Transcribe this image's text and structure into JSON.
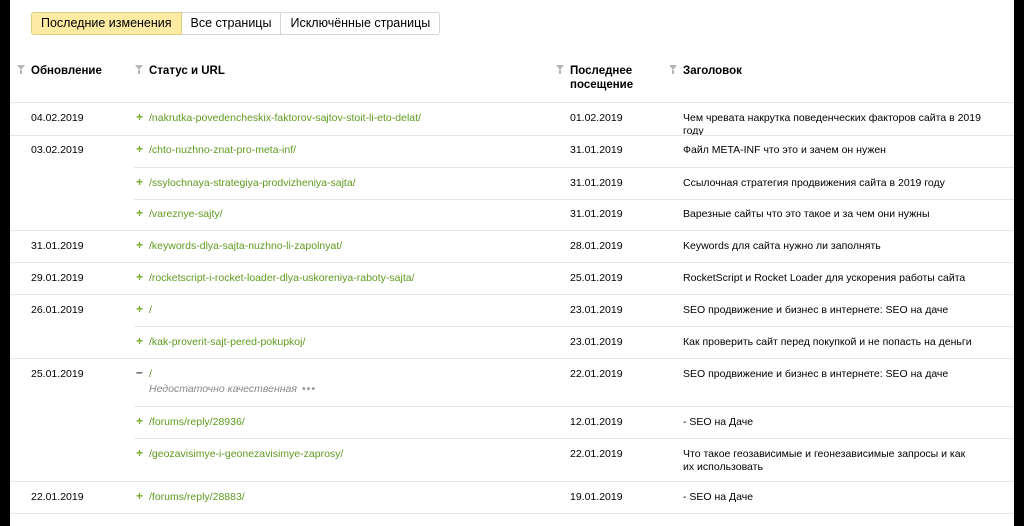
{
  "tabs": [
    {
      "label": "Последние изменения",
      "active": true
    },
    {
      "label": "Все страницы",
      "active": false
    },
    {
      "label": "Исключённые страницы",
      "active": false
    }
  ],
  "columns": {
    "updated": "Обновление",
    "status_url": "Статус и URL",
    "last_visit": "Последнее посещение",
    "title": "Заголовок"
  },
  "rows": [
    {
      "date": "04.02.2019",
      "status": "+",
      "url": "/nakrutka-povedencheskix-faktorov-sajtov-stoit-li-eto-delat/",
      "visit": "01.02.2019",
      "title": "Чем чревата накрутка поведенческих факторов сайта в 2019 году"
    },
    {
      "date": "03.02.2019",
      "status": "+",
      "url": "/chto-nuzhno-znat-pro-meta-inf/",
      "visit": "31.01.2019",
      "title": "Файл META-INF что это и зачем он нужен"
    },
    {
      "date": "",
      "status": "+",
      "url": "/ssylochnaya-strategiya-prodvizheniya-sajta/",
      "visit": "31.01.2019",
      "title": "Ссылочная стратегия продвижения сайта в 2019 году"
    },
    {
      "date": "",
      "status": "+",
      "url": "/vareznye-sajty/",
      "visit": "31.01.2019",
      "title": "Варезные сайты что это такое и за чем они нужны"
    },
    {
      "date": "31.01.2019",
      "status": "+",
      "url": "/keywords-dlya-sajta-nuzhno-li-zapolnyat/",
      "visit": "28.01.2019",
      "title": "Keywords для сайта нужно ли заполнять"
    },
    {
      "date": "29.01.2019",
      "status": "+",
      "url": "/rocketscript-i-rocket-loader-dlya-uskoreniya-raboty-sajta/",
      "visit": "25.01.2019",
      "title": "RocketScript и Rocket Loader для ускорения работы сайта"
    },
    {
      "date": "26.01.2019",
      "status": "+",
      "url": "/",
      "visit": "23.01.2019",
      "title": "SEO продвижение и бизнес в интернете: SEO на даче"
    },
    {
      "date": "",
      "status": "+",
      "url": "/kak-proverit-sajt-pered-pokupkoj/",
      "visit": "23.01.2019",
      "title": "Как проверить сайт перед покупкой и не попасть на деньги"
    },
    {
      "date": "25.01.2019",
      "status": "–",
      "url": "/",
      "note": "Недостаточно качественная",
      "note_more": "•••",
      "visit": "22.01.2019",
      "title": "SEO продвижение и бизнес в интернете: SEO на даче"
    },
    {
      "date": "",
      "status": "+",
      "url": "/forums/reply/28936/",
      "visit": "12.01.2019",
      "title": "- SEO на Даче"
    },
    {
      "date": "",
      "status": "+",
      "url": "/geozavisimye-i-geonezavisimye-zaprosy/",
      "visit": "22.01.2019",
      "title": "Что такое геозависимые и геонезависимые запросы и как их использовать"
    },
    {
      "date": "22.01.2019",
      "status": "+",
      "url": "/forums/reply/28883/",
      "visit": "19.01.2019",
      "title": "- SEO на Даче"
    }
  ]
}
